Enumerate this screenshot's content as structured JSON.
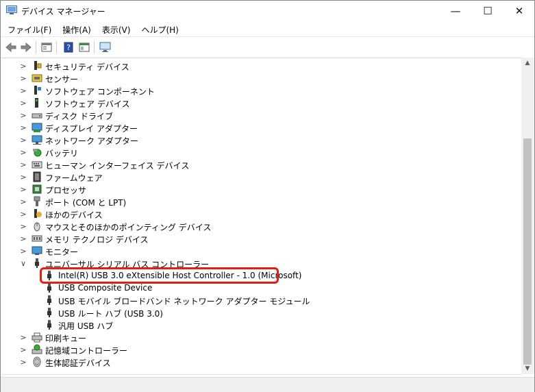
{
  "window": {
    "title": "デバイス マネージャー",
    "minimize_glyph": "—",
    "maximize_glyph": "☐",
    "close_glyph": "✕"
  },
  "menu": [
    "ファイル(F)",
    "操作(A)",
    "表示(V)",
    "ヘルプ(H)"
  ],
  "colors": {
    "highlight_border": "#e41e16",
    "scroll_thumb": "#c2c2c2"
  },
  "tree": {
    "categories": [
      {
        "label": "セキュリティ デバイス",
        "icon": "security-device-icon",
        "expanded": false
      },
      {
        "label": "センサー",
        "icon": "sensor-icon",
        "expanded": false
      },
      {
        "label": "ソフトウェア コンポーネント",
        "icon": "software-component-icon",
        "expanded": false
      },
      {
        "label": "ソフトウェア デバイス",
        "icon": "software-device-icon",
        "expanded": false
      },
      {
        "label": "ディスク ドライブ",
        "icon": "disk-drive-icon",
        "expanded": false
      },
      {
        "label": "ディスプレイ アダプター",
        "icon": "display-adapter-icon",
        "expanded": false
      },
      {
        "label": "ネットワーク アダプター",
        "icon": "network-adapter-icon",
        "expanded": false
      },
      {
        "label": "バッテリ",
        "icon": "battery-icon",
        "expanded": false
      },
      {
        "label": "ヒューマン インターフェイス デバイス",
        "icon": "hid-icon",
        "expanded": false
      },
      {
        "label": "ファームウェア",
        "icon": "firmware-icon",
        "expanded": false
      },
      {
        "label": "プロセッサ",
        "icon": "processor-icon",
        "expanded": false
      },
      {
        "label": "ポート (COM と LPT)",
        "icon": "port-icon",
        "expanded": false
      },
      {
        "label": "ほかのデバイス",
        "icon": "other-device-icon",
        "expanded": false
      },
      {
        "label": "マウスとそのほかのポインティング デバイス",
        "icon": "mouse-icon",
        "expanded": false
      },
      {
        "label": "メモリ テクノロジ デバイス",
        "icon": "memory-icon",
        "expanded": false
      },
      {
        "label": "モニター",
        "icon": "monitor-icon",
        "expanded": false
      },
      {
        "label": "ユニバーサル シリアル バス コントローラー",
        "icon": "usb-icon",
        "expanded": true
      }
    ],
    "usb_children": [
      "Intel(R) USB 3.0 eXtensible Host Controller - 1.0 (Microsoft)",
      "USB Composite Device",
      "USB モバイル ブロードバンド ネットワーク アダプター モジュール",
      "USB ルート ハブ (USB 3.0)",
      "汎用 USB ハブ"
    ],
    "trailing_categories": [
      {
        "label": "印刷キュー",
        "icon": "print-queue-icon"
      },
      {
        "label": "記憶域コントローラー",
        "icon": "storage-controller-icon"
      },
      {
        "label": "生体認証デバイス",
        "icon": "biometric-icon"
      }
    ],
    "highlighted_child": "Intel(R) USB 3.0 eXtensible Host Controller - 1.0 (Microsoft)"
  }
}
